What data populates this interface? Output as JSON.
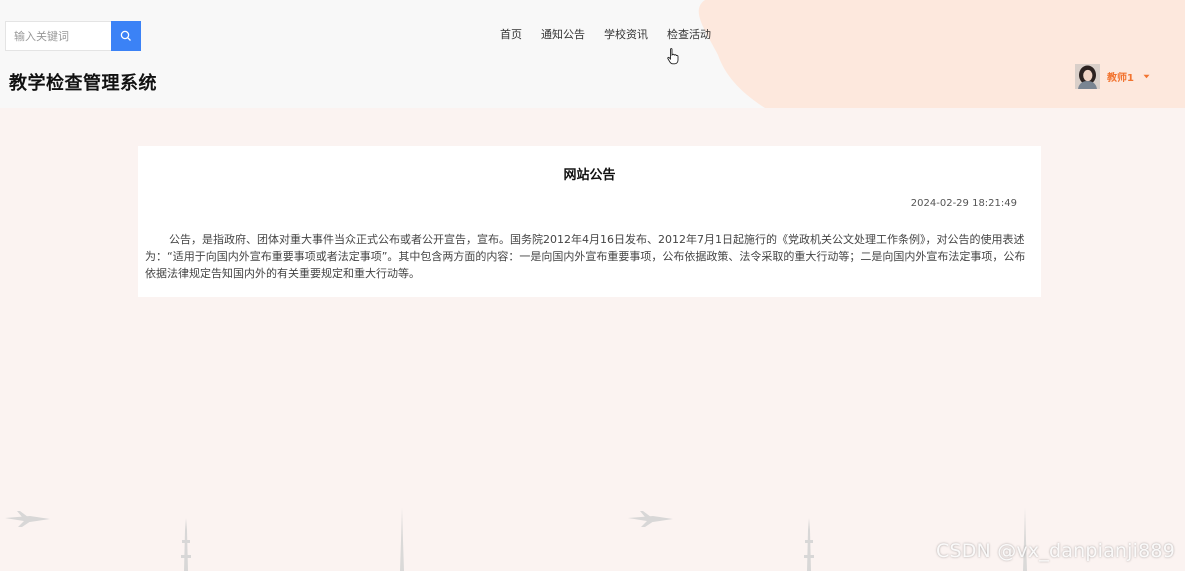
{
  "search": {
    "placeholder": "输入关键词"
  },
  "nav": {
    "items": [
      {
        "label": "首页"
      },
      {
        "label": "通知公告"
      },
      {
        "label": "学校资讯"
      },
      {
        "label": "检查活动"
      }
    ]
  },
  "site": {
    "title": "教学检查管理系统"
  },
  "user": {
    "name": "教师1"
  },
  "notice": {
    "title": "网站公告",
    "date": "2024-02-29 18:21:49",
    "body": "公告，是指政府、团体对重大事件当众正式公布或者公开宣告，宣布。国务院2012年4月16日发布、2012年7月1日起施行的《党政机关公文处理工作条例》，对公告的使用表述为：“适用于向国内外宣布重要事项或者法定事项”。其中包含两方面的内容：一是向国内外宣布重要事项，公布依据政策、法令采取的重大行动等；二是向国内外宣布法定事项，公布依据法律规定告知国内外的有关重要规定和重大行动等。"
  },
  "watermark": "CSDN @vx_danpianji889",
  "colors": {
    "accent": "#3b82f6",
    "user_name": "#f27430",
    "header_peach": "#fde8dd",
    "page_bg": "#fbf3f1"
  }
}
